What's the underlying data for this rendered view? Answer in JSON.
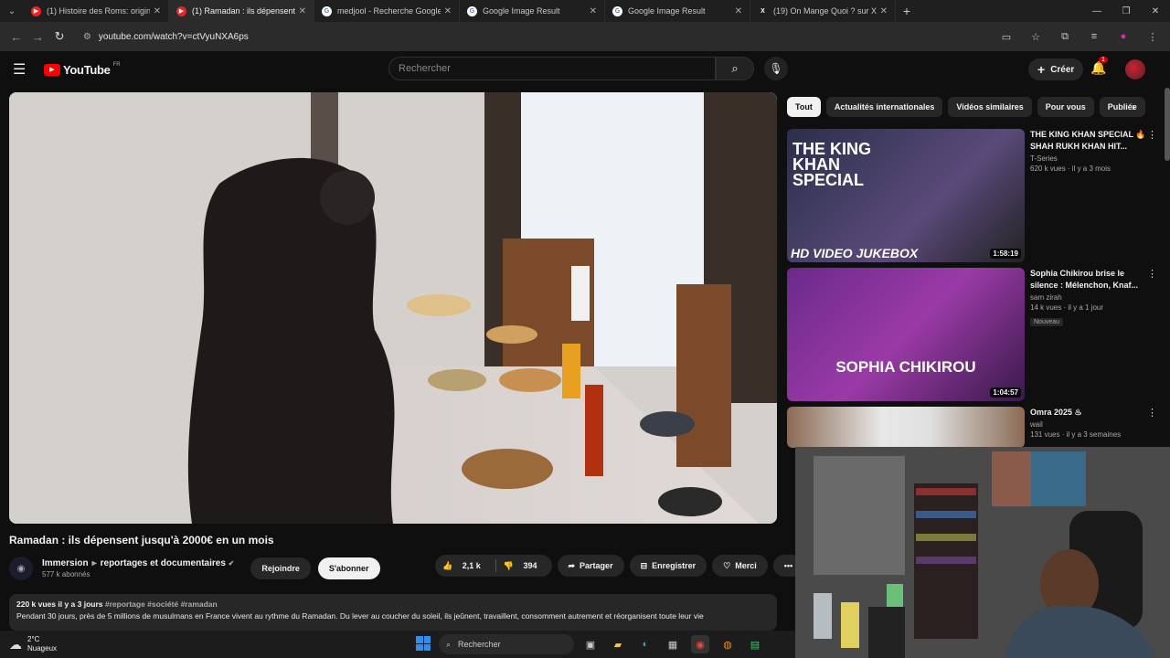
{
  "browser": {
    "tabs": [
      {
        "title": "(1) Histoire des Roms: origine e",
        "icon": "youtube-icon"
      },
      {
        "title": "(1) Ramadan : ils dépensent jus",
        "icon": "youtube-icon",
        "active": true
      },
      {
        "title": "medjool - Recherche Google",
        "icon": "google-icon"
      },
      {
        "title": "Google Image Result",
        "icon": "google-icon"
      },
      {
        "title": "Google Image Result",
        "icon": "google-icon"
      },
      {
        "title": "(19) On Mange Quoi ? sur X : \"",
        "icon": "x-icon"
      }
    ],
    "url": "youtube.com/watch?v=ctVyuNXA6ps"
  },
  "header": {
    "logo_text": "YouTube",
    "country": "FR",
    "search_placeholder": "Rechercher",
    "create_label": "Créer",
    "notification_count": "1"
  },
  "video": {
    "title": "Ramadan : ils dépensent jusqu'à 2000€ en un mois",
    "channel": "Immersion",
    "channel_suffix": "reportages et documentaires",
    "subscribers": "577 k abonnés",
    "join_label": "Rejoindre",
    "subscribe_label": "S'abonner",
    "likes": "2,1 k",
    "dislikes": "394",
    "share_label": "Partager",
    "save_label": "Enregistrer",
    "thanks_label": "Merci",
    "views_date": "220 k vues  il y a 3 jours",
    "tags": "#reportage #société #ramadan",
    "description": "Pendant 30 jours, près de 5 millions de musulmans en France vivent au rythme du Ramadan. Du lever au coucher du soleil, ils jeûnent, travaillent, consomment autrement et réorganisent toute leur vie"
  },
  "chips": [
    "Tout",
    "Actualités internationales",
    "Vidéos similaires",
    "Pour vous",
    "Publiée"
  ],
  "recommendations": [
    {
      "title": "THE KING KHAN SPECIAL 🔥 SHAH RUKH KHAN HIT...",
      "channel": "T-Series",
      "meta": "620 k vues · il y a 3 mois",
      "duration": "1:58:19",
      "thumb_text_1": "THE KING KHAN SPECIAL",
      "thumb_text_2": "HD VIDEO JUKEBOX"
    },
    {
      "title": "Sophia Chikirou brise le silence : Mélenchon, Knaf...",
      "channel": "sam zirah",
      "meta": "14 k vues · il y a 1 jour",
      "badge": "Nouveau",
      "duration": "1:04:57",
      "thumb_text_1": "SOPHIA CHIKIROU"
    },
    {
      "title": "Omra 2025 ♨",
      "channel": "wail",
      "meta": "131 vues · il y a 3 semaines"
    }
  ],
  "taskbar": {
    "temp": "2°C",
    "weather": "Nuageux",
    "search_label": "Rechercher"
  }
}
